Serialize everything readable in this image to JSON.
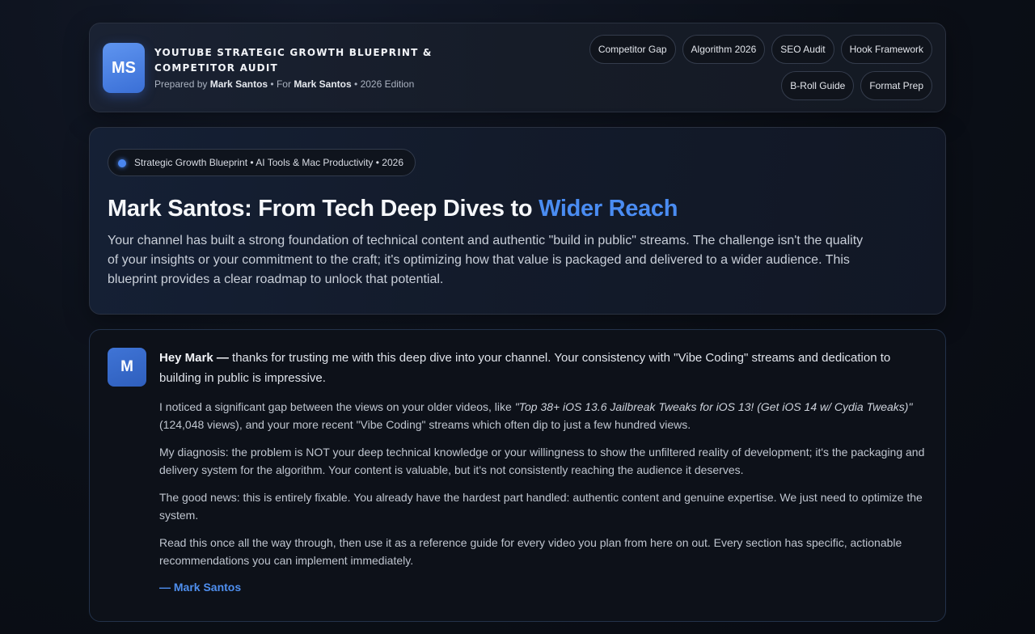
{
  "header": {
    "logo": "MS",
    "title": "YouTube Strategic Growth Blueprint & Competitor Audit",
    "prepared_label": "Prepared by",
    "prepared_by": "Mark Santos",
    "sep1": "•",
    "for_label": "For",
    "for_name": "Mark Santos",
    "sep2": "•",
    "edition": "2026 Edition",
    "chips": [
      "Competitor Gap",
      "Algorithm 2026",
      "SEO Audit",
      "Hook Framework",
      "B-Roll Guide",
      "Format Prep"
    ]
  },
  "hero": {
    "badge": "Strategic Growth Blueprint • AI Tools & Mac Productivity • 2026",
    "title_main": "Mark Santos: From Tech Deep Dives to",
    "title_accent": "Wider Reach",
    "text": "Your channel has built a strong foundation of technical content and authentic \"build in public\" streams. The challenge isn't the quality of your insights or your commitment to the craft; it's optimizing how that value is packaged and delivered to a wider audience. This blueprint provides a clear roadmap to unlock that potential."
  },
  "letter": {
    "avatar": "M",
    "greeting_bold": "Hey Mark —",
    "greeting_rest": "thanks for trusting me with this deep dive into your channel. Your consistency with \"Vibe Coding\" streams and dedication to building in public is impressive.",
    "p1_before": "I noticed a significant gap between the views on your older videos, like",
    "p1_video": "\"Top 38+ iOS 13.6 Jailbreak Tweaks for iOS 13! (Get iOS 14 w/ Cydia Tweaks)\"",
    "p1_after": "(124,048 views), and your more recent \"Vibe Coding\" streams which often dip to just a few hundred views.",
    "p2": "My diagnosis: the problem is NOT your deep technical knowledge or your willingness to show the unfiltered reality of development; it's the packaging and delivery system for the algorithm. Your content is valuable, but it's not consistently reaching the audience it deserves.",
    "p3": "The good news: this is entirely fixable. You already have the hardest part handled: authentic content and genuine expertise. We just need to optimize the system.",
    "p4": "Read this once all the way through, then use it as a reference guide for every video you plan from here on out. Every section has specific, actionable recommendations you can implement immediately.",
    "signature": "— Mark Santos"
  },
  "colors": {
    "accent": "#4a8cf2",
    "background": "#0b0f17"
  }
}
